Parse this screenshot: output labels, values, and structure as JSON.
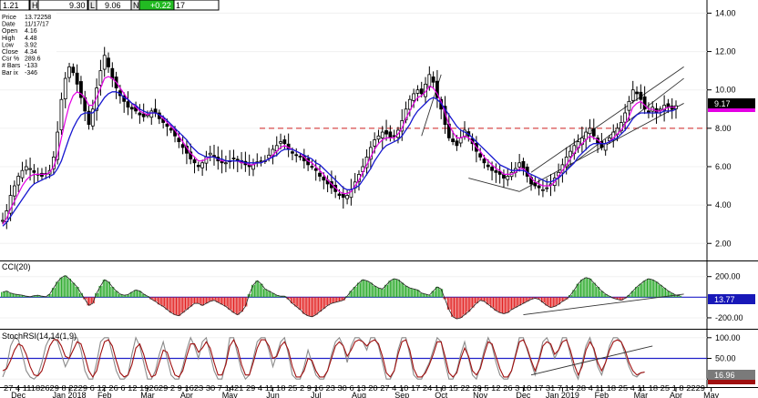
{
  "topbar": {
    "left_value": "1.21",
    "h_label": "H",
    "h_value": "9.30",
    "l_label": "L",
    "l_value": "9.06",
    "n_label": "N",
    "n_value": "+0.22",
    "right_value": "17"
  },
  "infobox": {
    "lines": [
      {
        "label": "Price",
        "value": "13.72258"
      },
      {
        "label": "Date",
        "value": "11/17/17"
      },
      {
        "label": "Open",
        "value": "4.16"
      },
      {
        "label": "High",
        "value": "4.48"
      },
      {
        "label": "Low",
        "value": "3.92"
      },
      {
        "label": "Close",
        "value": "4.34"
      },
      {
        "label": "Csr %",
        "value": "289.6"
      },
      {
        "label": "# Bars",
        "value": "-133"
      },
      {
        "label": "Bar ix",
        "value": "-346"
      }
    ]
  },
  "colors": {
    "price": "#000000",
    "ma_fast": "#e400e4",
    "ma_slow": "#1818d0",
    "cci_pos": "#26a826",
    "cci_neg": "#e21c1c",
    "stoch_k": "#8a8a8a",
    "stoch_d": "#a01010",
    "level_line": "#2020c8",
    "dashed_level": "#d02020",
    "current_bg": "#000000",
    "cci_tag_bg": "#1818b8",
    "stoch_tag_bg": "#7a7a7a",
    "topbar_green": "#22bb22"
  },
  "price_panel": {
    "yticks": [
      "2.00",
      "4.00",
      "6.00",
      "8.00",
      "10.00",
      "12.00",
      "14.00"
    ],
    "ytick_values": [
      2,
      4,
      6,
      8,
      10,
      12,
      14
    ],
    "ylim": [
      1.3,
      14.4
    ],
    "dashed_level": 8.0,
    "current_price": "9.17",
    "current_value": 9.17
  },
  "cci_panel": {
    "title": "CCI(20)",
    "yticks": [
      "200.00",
      "-200.00"
    ],
    "ytick_values": [
      200,
      -200
    ],
    "ylim": [
      -280,
      330
    ],
    "zero_level": 0,
    "current": "13.77"
  },
  "stoch_panel": {
    "title": "StochRSI(14,14(1,9)",
    "yticks": [
      "100.00",
      "50.00",
      "0.00"
    ],
    "ytick_values": [
      100,
      50,
      0
    ],
    "ylim": [
      -15,
      115
    ],
    "mid_level": 50,
    "current": "16.96"
  },
  "xaxis": {
    "day_ticks": [
      "27",
      "4",
      "11",
      "18",
      "26",
      "2",
      "8",
      "22",
      "29",
      "5",
      "12",
      "26",
      "5",
      "12",
      "19",
      "26",
      "2",
      "9",
      "16",
      "23",
      "30",
      "7",
      "14",
      "21",
      "29",
      "4",
      "11",
      "18",
      "25",
      "2",
      "9",
      "16",
      "23",
      "30",
      "6",
      "13",
      "20",
      "27",
      "4",
      "10",
      "17",
      "24",
      "1",
      "8",
      "15",
      "22",
      "29",
      "5",
      "12",
      "26",
      "3",
      "10",
      "17",
      "31",
      "7",
      "14",
      "28",
      "4",
      "11",
      "18",
      "25",
      "4",
      "11",
      "18",
      "25",
      "1",
      "8",
      "22",
      "29"
    ],
    "day_tick_text": "27 4 11182629 8  2229 6 12   26 6 12 192629 2  9 1623 30 7 1421 29 4 11 18 25 2 9 16 23 30 6 13 20 27 4 10 17 24 1 8 15 22 29 5 12 26 3 10 17 31 7 14 28 4 11 18 25 4 11 18 25 1 8   2229",
    "months": [
      {
        "label": "Dec",
        "i": 4
      },
      {
        "label": "Jan 2018",
        "i": 17
      },
      {
        "label": "Feb",
        "i": 26
      },
      {
        "label": "Mar",
        "i": 37
      },
      {
        "label": "Apr",
        "i": 47
      },
      {
        "label": "May",
        "i": 58
      },
      {
        "label": "Jun",
        "i": 69
      },
      {
        "label": "Jul",
        "i": 80
      },
      {
        "label": "Aug",
        "i": 91
      },
      {
        "label": "Sep",
        "i": 102
      },
      {
        "label": "Oct",
        "i": 112
      },
      {
        "label": "Nov",
        "i": 122
      },
      {
        "label": "Dec",
        "i": 133
      },
      {
        "label": "Jan 2019",
        "i": 143
      },
      {
        "label": "Feb",
        "i": 153
      },
      {
        "label": "Mar",
        "i": 163
      },
      {
        "label": "Apr",
        "i": 172
      },
      {
        "label": "May",
        "i": 181
      }
    ]
  },
  "chart_data": {
    "type": "candlestick",
    "title": "",
    "bar_count": 175,
    "closes": [
      3.2,
      3.7,
      4.5,
      5.0,
      5.5,
      5.8,
      6.0,
      5.9,
      5.7,
      5.6,
      5.5,
      5.6,
      5.8,
      6.5,
      7.8,
      9.5,
      10.6,
      11.2,
      10.9,
      10.3,
      9.6,
      8.9,
      8.2,
      9.0,
      10.1,
      11.0,
      11.8,
      11.2,
      10.6,
      10.1,
      9.7,
      9.4,
      9.1,
      9.0,
      8.9,
      8.7,
      8.6,
      8.7,
      8.9,
      8.8,
      8.5,
      8.3,
      8.1,
      7.9,
      7.6,
      7.3,
      7.0,
      6.7,
      6.4,
      6.2,
      6.0,
      6.2,
      6.5,
      6.7,
      6.5,
      6.3,
      6.2,
      6.2,
      6.3,
      6.4,
      6.3,
      6.2,
      6.1,
      6.0,
      6.1,
      6.2,
      6.3,
      6.3,
      6.6,
      6.9,
      7.1,
      7.3,
      7.2,
      6.9,
      6.7,
      6.6,
      6.5,
      6.3,
      6.1,
      6.0,
      5.8,
      5.5,
      5.3,
      5.1,
      4.9,
      4.7,
      4.5,
      4.4,
      4.5,
      4.8,
      5.2,
      5.6,
      6.0,
      6.5,
      7.0,
      7.4,
      7.6,
      7.8,
      7.7,
      7.5,
      7.6,
      7.9,
      8.4,
      9.0,
      9.5,
      9.8,
      10.0,
      9.8,
      10.3,
      10.8,
      10.4,
      9.6,
      9.0,
      8.2,
      7.5,
      7.3,
      7.1,
      7.5,
      7.9,
      7.6,
      7.2,
      6.8,
      6.5,
      6.2,
      6.0,
      5.8,
      5.7,
      5.6,
      5.4,
      5.5,
      5.7,
      5.9,
      6.2,
      5.9,
      5.5,
      5.1,
      5.0,
      4.9,
      4.8,
      4.9,
      5.1,
      5.4,
      5.7,
      6.1,
      6.5,
      6.8,
      7.1,
      7.3,
      7.5,
      7.8,
      8.0,
      7.6,
      7.2,
      7.0,
      7.2,
      7.5,
      7.8,
      8.0,
      8.3,
      8.8,
      9.4,
      10.0,
      9.8,
      9.5,
      9.0,
      8.8,
      9.1,
      8.8,
      9.0,
      9.2,
      9.1,
      9.0,
      9.17
    ],
    "ma_fast": [
      3.0,
      3.3,
      3.8,
      4.2,
      4.6,
      5.0,
      5.3,
      5.5,
      5.6,
      5.6,
      5.6,
      5.6,
      5.7,
      6.0,
      6.6,
      7.5,
      8.4,
      9.2,
      9.7,
      9.9,
      9.8,
      9.6,
      9.2,
      9.2,
      9.6,
      10.1,
      10.6,
      10.7,
      10.6,
      10.4,
      10.1,
      9.8,
      9.5,
      9.3,
      9.1,
      8.9,
      8.8,
      8.7,
      8.8,
      8.8,
      8.7,
      8.5,
      8.3,
      8.1,
      7.9,
      7.6,
      7.3,
      7.0,
      6.7,
      6.5,
      6.3,
      6.3,
      6.4,
      6.5,
      6.5,
      6.4,
      6.3,
      6.3,
      6.3,
      6.3,
      6.3,
      6.2,
      6.2,
      6.1,
      6.1,
      6.2,
      6.2,
      6.3,
      6.4,
      6.6,
      6.8,
      7.0,
      7.1,
      7.0,
      6.9,
      6.8,
      6.7,
      6.5,
      6.3,
      6.2,
      6.0,
      5.8,
      5.6,
      5.3,
      5.1,
      4.9,
      4.7,
      4.6,
      4.6,
      4.7,
      5.0,
      5.3,
      5.7,
      6.1,
      6.5,
      6.9,
      7.2,
      7.4,
      7.5,
      7.5,
      7.5,
      7.7,
      8.0,
      8.5,
      8.9,
      9.3,
      9.6,
      9.7,
      9.9,
      10.2,
      10.1,
      9.8,
      9.4,
      8.8,
      8.2,
      7.8,
      7.5,
      7.5,
      7.6,
      7.5,
      7.3,
      7.0,
      6.8,
      6.5,
      6.3,
      6.1,
      5.9,
      5.8,
      5.6,
      5.6,
      5.6,
      5.7,
      5.9,
      5.9,
      5.7,
      5.4,
      5.2,
      5.1,
      5.0,
      5.0,
      5.0,
      5.2,
      5.5,
      5.8,
      6.1,
      6.4,
      6.7,
      7.0,
      7.2,
      7.4,
      7.6,
      7.5,
      7.4,
      7.2,
      7.2,
      7.3,
      7.5,
      7.7,
      7.9,
      8.2,
      8.6,
      9.1,
      9.3,
      9.4,
      9.2,
      9.0,
      9.0,
      8.9,
      8.9,
      9.0,
      9.1,
      9.1,
      9.1
    ],
    "ma_slow": [
      2.9,
      3.1,
      3.4,
      3.7,
      4.0,
      4.3,
      4.6,
      4.9,
      5.1,
      5.2,
      5.3,
      5.4,
      5.5,
      5.6,
      5.9,
      6.3,
      6.9,
      7.5,
      8.0,
      8.4,
      8.7,
      8.8,
      8.8,
      8.8,
      9.0,
      9.3,
      9.6,
      9.8,
      9.9,
      9.9,
      9.8,
      9.6,
      9.5,
      9.3,
      9.2,
      9.0,
      8.9,
      8.8,
      8.8,
      8.8,
      8.7,
      8.6,
      8.4,
      8.2,
      8.0,
      7.8,
      7.6,
      7.4,
      7.1,
      6.9,
      6.7,
      6.6,
      6.5,
      6.5,
      6.5,
      6.4,
      6.4,
      6.3,
      6.3,
      6.3,
      6.3,
      6.3,
      6.2,
      6.2,
      6.2,
      6.2,
      6.2,
      6.3,
      6.4,
      6.5,
      6.6,
      6.8,
      6.9,
      6.9,
      6.9,
      6.8,
      6.7,
      6.6,
      6.5,
      6.4,
      6.2,
      6.1,
      5.9,
      5.7,
      5.5,
      5.3,
      5.1,
      4.9,
      4.8,
      4.8,
      4.9,
      5.0,
      5.3,
      5.6,
      5.9,
      6.3,
      6.6,
      6.9,
      7.1,
      7.2,
      7.3,
      7.4,
      7.6,
      7.9,
      8.2,
      8.6,
      8.9,
      9.1,
      9.3,
      9.5,
      9.6,
      9.5,
      9.3,
      9.0,
      8.7,
      8.4,
      8.1,
      7.9,
      7.8,
      7.7,
      7.5,
      7.3,
      7.1,
      6.9,
      6.7,
      6.5,
      6.3,
      6.1,
      6.0,
      5.9,
      5.8,
      5.8,
      5.8,
      5.8,
      5.7,
      5.6,
      5.5,
      5.4,
      5.3,
      5.2,
      5.2,
      5.3,
      5.4,
      5.6,
      5.8,
      6.0,
      6.2,
      6.5,
      6.7,
      6.9,
      7.1,
      7.2,
      7.2,
      7.2,
      7.2,
      7.3,
      7.4,
      7.5,
      7.7,
      7.9,
      8.2,
      8.5,
      8.7,
      8.8,
      8.8,
      8.8,
      8.8,
      8.8,
      8.8,
      8.9,
      8.9,
      8.9,
      9.0
    ],
    "cci": [
      50,
      60,
      40,
      30,
      25,
      20,
      10,
      5,
      15,
      20,
      10,
      5,
      30,
      90,
      150,
      190,
      210,
      180,
      140,
      100,
      40,
      -20,
      -80,
      -60,
      40,
      110,
      170,
      150,
      100,
      60,
      30,
      20,
      25,
      50,
      70,
      60,
      30,
      10,
      -20,
      -40,
      -70,
      -90,
      -120,
      -150,
      -170,
      -180,
      -150,
      -120,
      -90,
      -60,
      -60,
      -80,
      -60,
      -40,
      -30,
      -50,
      -70,
      -90,
      -120,
      -150,
      -170,
      -140,
      -90,
      30,
      120,
      160,
      130,
      80,
      60,
      40,
      20,
      10,
      10,
      -20,
      -60,
      -90,
      -120,
      -160,
      -180,
      -190,
      -170,
      -140,
      -110,
      -80,
      -60,
      -50,
      -40,
      -30,
      10,
      60,
      100,
      140,
      170,
      160,
      140,
      110,
      90,
      80,
      120,
      160,
      180,
      170,
      140,
      110,
      90,
      80,
      70,
      40,
      30,
      20,
      60,
      100,
      80,
      -20,
      -120,
      -190,
      -210,
      -200,
      -170,
      -140,
      -100,
      -60,
      -30,
      -40,
      -70,
      -100,
      -130,
      -150,
      -160,
      -150,
      -120,
      -100,
      -80,
      -60,
      -40,
      -20,
      -10,
      -20,
      -50,
      -80,
      -100,
      -90,
      -70,
      -40,
      -20,
      20,
      70,
      130,
      170,
      190,
      180,
      140,
      100,
      60,
      30,
      10,
      -10,
      -20,
      -30,
      -10,
      20,
      60,
      100,
      130,
      160,
      180,
      170,
      150,
      120,
      90,
      60,
      40,
      20,
      14
    ],
    "stoch_k": [
      5,
      30,
      80,
      100,
      95,
      60,
      20,
      5,
      0,
      10,
      40,
      80,
      100,
      100,
      90,
      60,
      30,
      50,
      100,
      100,
      70,
      20,
      0,
      0,
      40,
      90,
      100,
      100,
      60,
      20,
      0,
      0,
      10,
      60,
      100,
      80,
      40,
      0,
      0,
      20,
      60,
      90,
      50,
      10,
      0,
      0,
      30,
      70,
      100,
      80,
      50,
      90,
      100,
      60,
      20,
      0,
      0,
      40,
      100,
      100,
      60,
      20,
      0,
      10,
      50,
      90,
      100,
      100,
      70,
      30,
      60,
      90,
      100,
      60,
      10,
      0,
      0,
      30,
      70,
      40,
      10,
      0,
      0,
      20,
      60,
      90,
      100,
      80,
      40,
      80,
      100,
      100,
      90,
      70,
      100,
      100,
      80,
      40,
      0,
      0,
      20,
      70,
      100,
      100,
      60,
      10,
      0,
      0,
      20,
      40,
      70,
      100,
      90,
      40,
      0,
      0,
      20,
      60,
      90,
      50,
      10,
      0,
      30,
      70,
      100,
      80,
      40,
      10,
      0,
      0,
      20,
      60,
      100,
      100,
      70,
      40,
      10,
      50,
      90,
      100,
      80,
      50,
      70,
      100,
      100,
      60,
      20,
      0,
      40,
      80,
      100,
      70,
      30,
      10,
      40,
      80,
      100,
      100,
      90,
      60,
      30,
      10,
      5,
      15,
      17
    ],
    "stoch_d": [
      20,
      25,
      45,
      70,
      85,
      80,
      60,
      30,
      10,
      8,
      20,
      50,
      80,
      95,
      95,
      80,
      55,
      50,
      70,
      90,
      85,
      55,
      20,
      5,
      20,
      60,
      90,
      95,
      80,
      45,
      15,
      5,
      10,
      35,
      75,
      85,
      60,
      25,
      5,
      10,
      40,
      70,
      65,
      35,
      10,
      5,
      20,
      55,
      85,
      85,
      65,
      75,
      90,
      75,
      40,
      10,
      10,
      35,
      80,
      95,
      75,
      35,
      10,
      10,
      40,
      75,
      95,
      95,
      80,
      50,
      55,
      80,
      90,
      70,
      30,
      5,
      5,
      20,
      50,
      45,
      20,
      5,
      5,
      20,
      50,
      80,
      90,
      80,
      55,
      70,
      90,
      95,
      90,
      80,
      90,
      95,
      85,
      55,
      15,
      5,
      20,
      60,
      90,
      95,
      70,
      25,
      5,
      5,
      15,
      35,
      60,
      90,
      90,
      55,
      15,
      5,
      15,
      50,
      75,
      55,
      20,
      10,
      25,
      60,
      90,
      85,
      55,
      25,
      5,
      5,
      20,
      55,
      90,
      95,
      75,
      45,
      20,
      45,
      80,
      90,
      85,
      60,
      70,
      90,
      95,
      70,
      35,
      10,
      30,
      70,
      90,
      75,
      40,
      20,
      40,
      70,
      90,
      95,
      90,
      70,
      40,
      20,
      10,
      15,
      17
    ]
  }
}
